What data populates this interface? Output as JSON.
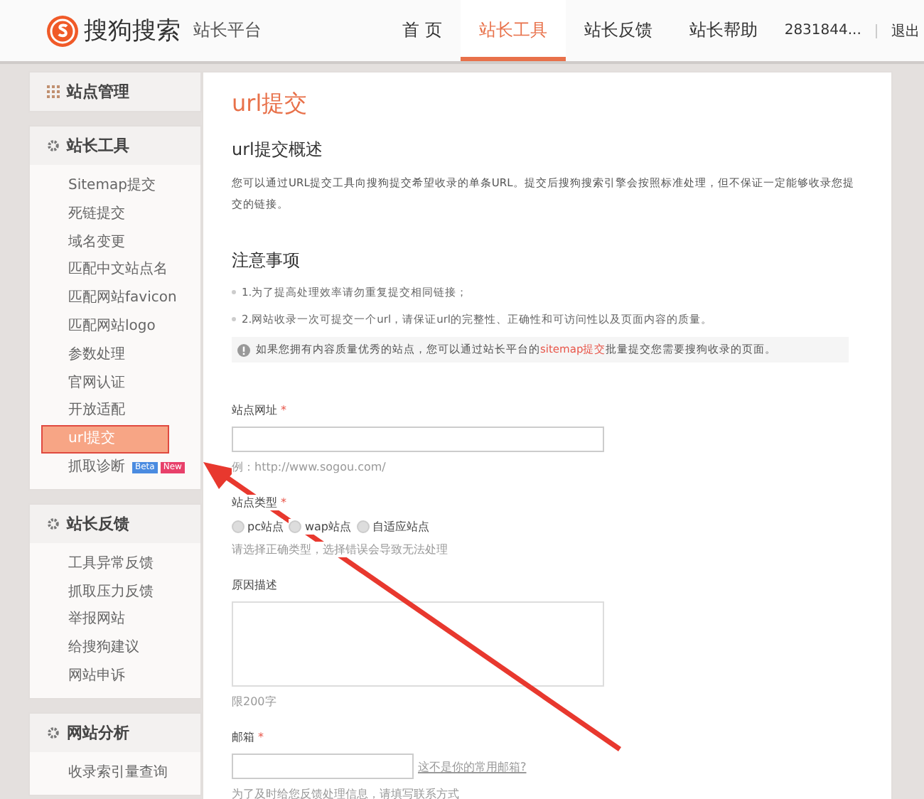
{
  "header": {
    "brand": "搜狗搜索",
    "subtitle": "站长平台",
    "nav": [
      {
        "label": "首 页",
        "selected": false
      },
      {
        "label": "站长工具",
        "selected": true
      },
      {
        "label": "站长反馈",
        "selected": false
      },
      {
        "label": "站长帮助",
        "selected": false
      }
    ],
    "user": "2831844...",
    "logout": "退出"
  },
  "sidebar": [
    {
      "title": "站点管理"
    },
    {
      "title": "站长工具",
      "items": [
        {
          "label": "Sitemap提交",
          "selected": false
        },
        {
          "label": "死链提交",
          "selected": false
        },
        {
          "label": "域名变更",
          "selected": false
        },
        {
          "label": "匹配中文站点名",
          "selected": false
        },
        {
          "label": "匹配网站favicon",
          "selected": false
        },
        {
          "label": "匹配网站logo",
          "selected": false
        },
        {
          "label": "参数处理",
          "selected": false
        },
        {
          "label": "官网认证",
          "selected": false
        },
        {
          "label": "开放适配",
          "selected": false
        },
        {
          "label": "url提交",
          "selected": true
        },
        {
          "label": "抓取诊断",
          "selected": false,
          "badges": [
            "Beta",
            "New"
          ]
        }
      ]
    },
    {
      "title": "站长反馈",
      "items": [
        {
          "label": "工具异常反馈",
          "selected": false
        },
        {
          "label": "抓取压力反馈",
          "selected": false
        },
        {
          "label": "举报网站",
          "selected": false
        },
        {
          "label": "给搜狗建议",
          "selected": false
        },
        {
          "label": "网站申诉",
          "selected": false
        }
      ]
    },
    {
      "title": "网站分析",
      "items": [
        {
          "label": "收录索引量查询",
          "selected": false
        }
      ]
    }
  ],
  "content": {
    "title": "url提交",
    "overview_heading": "url提交概述",
    "overview": "您可以通过URL提交工具向搜狗提交希望收录的单条URL。提交后搜狗搜索引擎会按照标准处理，但不保证一定能够收录您提交的链接。",
    "notes_heading": "注意事项",
    "notes": [
      "1.为了提高处理效率请勿重复提交相同链接；",
      "2.网站收录一次可提交一个url，请保证url的完整性、正确性和可访问性以及页面内容的质量。"
    ],
    "tip": {
      "before": "如果您拥有内容质量优秀的站点，您可以通过站长平台的",
      "link": "sitemap提交",
      "after": "批量提交您需要搜狗收录的页面。"
    },
    "form": {
      "site_url": {
        "label": "站点网址",
        "required_mark": "*",
        "hint": "例：http://www.sogou.com/"
      },
      "site_type": {
        "label": "站点类型",
        "required_mark": "*",
        "options": [
          {
            "label": "pc站点",
            "selected": false
          },
          {
            "label": "wap站点",
            "selected": false
          },
          {
            "label": "自适应站点",
            "selected": false
          }
        ],
        "hint": "请选择正确类型，选择错误会导致无法处理"
      },
      "reason": {
        "label": "原因描述",
        "hint": "限200字"
      },
      "email": {
        "label": "邮箱",
        "required_mark": "*",
        "link": "这不是你的常用邮箱?",
        "hint": "为了及时给您反馈处理信息，请填写联系方式"
      }
    }
  }
}
